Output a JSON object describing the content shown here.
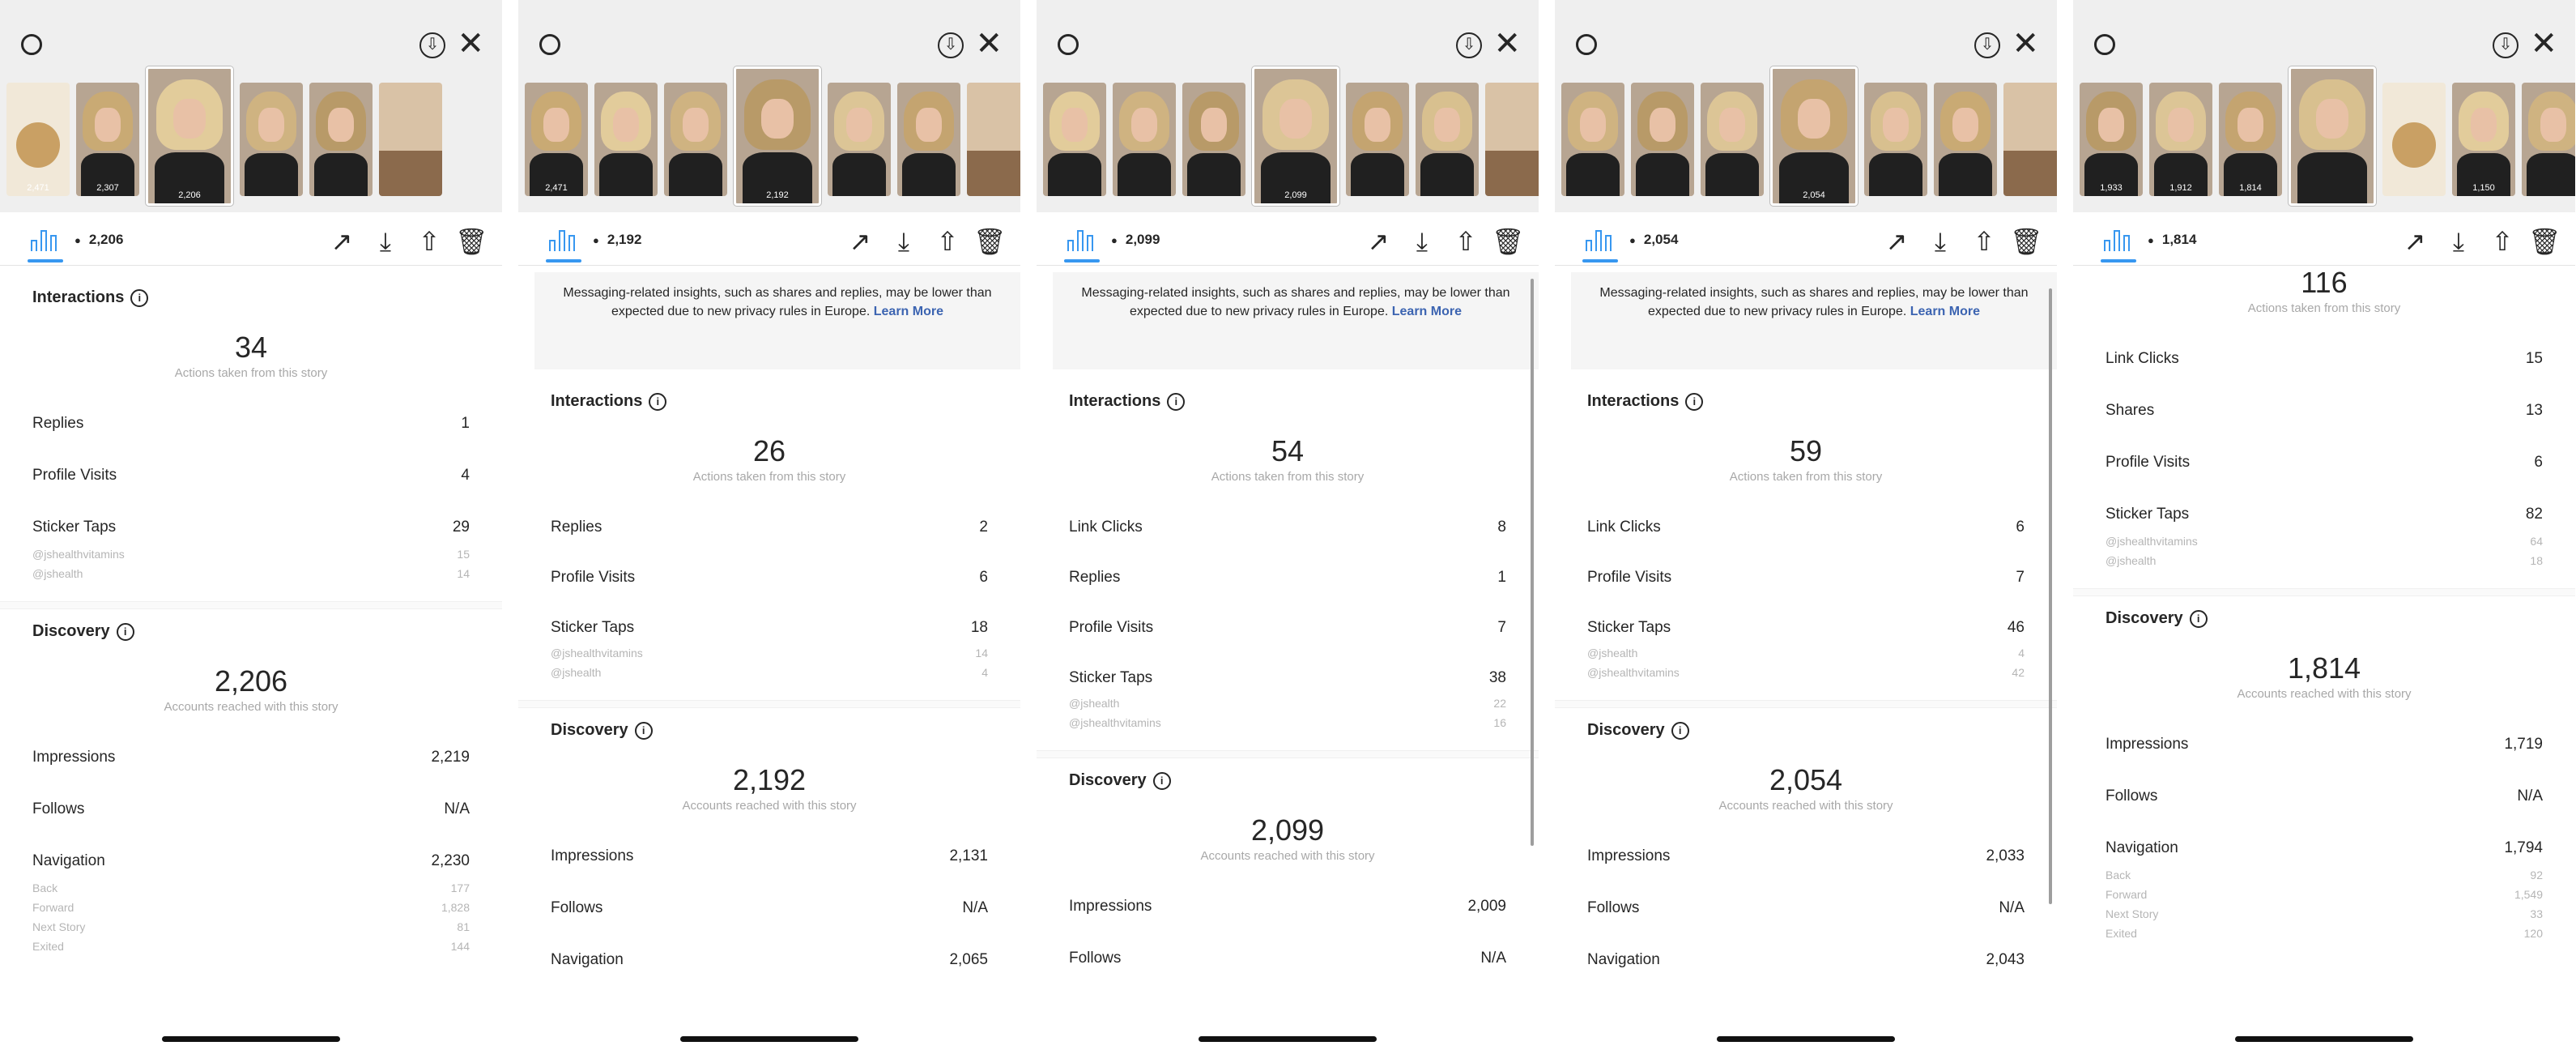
{
  "panels": [
    {
      "reach": "2,206",
      "notice": null,
      "interactions_label": "Interactions",
      "interactions_total": "34",
      "interactions_caption": "Actions taken from this story",
      "rows": [
        {
          "label": "Replies",
          "value": "1"
        },
        {
          "label": "Profile Visits",
          "value": "4"
        },
        {
          "label": "Sticker Taps",
          "value": "29",
          "subs": [
            {
              "label": "@jshealthvitamins",
              "value": "15"
            },
            {
              "label": "@jshealth",
              "value": "14"
            }
          ]
        }
      ],
      "discovery_label": "Discovery",
      "discovery_total": "2,206",
      "discovery_caption": "Accounts reached with this story",
      "discovery_rows": [
        {
          "label": "Impressions",
          "value": "2,219"
        },
        {
          "label": "Follows",
          "value": "N/A"
        },
        {
          "label": "Navigation",
          "value": "2,230",
          "subs": [
            {
              "label": "Back",
              "value": "177"
            },
            {
              "label": "Forward",
              "value": "1,828"
            },
            {
              "label": "Next Story",
              "value": "81"
            },
            {
              "label": "Exited",
              "value": "144"
            }
          ]
        }
      ]
    },
    {
      "reach": "2,192",
      "notice": {
        "text": "Messaging-related insights, such as shares and replies, may be lower than expected due to new privacy rules in Europe.",
        "link": "Learn More"
      },
      "interactions_label": "Interactions",
      "interactions_total": "26",
      "interactions_caption": "Actions taken from this story",
      "rows": [
        {
          "label": "Replies",
          "value": "2"
        },
        {
          "label": "Profile Visits",
          "value": "6"
        },
        {
          "label": "Sticker Taps",
          "value": "18",
          "subs": [
            {
              "label": "@jshealthvitamins",
              "value": "14"
            },
            {
              "label": "@jshealth",
              "value": "4"
            }
          ]
        }
      ],
      "discovery_label": "Discovery",
      "discovery_total": "2,192",
      "discovery_caption": "Accounts reached with this story",
      "discovery_rows": [
        {
          "label": "Impressions",
          "value": "2,131"
        },
        {
          "label": "Follows",
          "value": "N/A"
        },
        {
          "label": "Navigation",
          "value": "2,065"
        }
      ]
    },
    {
      "reach": "2,099",
      "notice": {
        "text": "Messaging-related insights, such as shares and replies, may be lower than expected due to new privacy rules in Europe.",
        "link": "Learn More"
      },
      "interactions_label": "Interactions",
      "interactions_total": "54",
      "interactions_caption": "Actions taken from this story",
      "rows": [
        {
          "label": "Link Clicks",
          "value": "8"
        },
        {
          "label": "Replies",
          "value": "1"
        },
        {
          "label": "Profile Visits",
          "value": "7"
        },
        {
          "label": "Sticker Taps",
          "value": "38",
          "subs": [
            {
              "label": "@jshealth",
              "value": "22"
            },
            {
              "label": "@jshealthvitamins",
              "value": "16"
            }
          ]
        }
      ],
      "discovery_label": "Discovery",
      "discovery_total": "2,099",
      "discovery_caption": "Accounts reached with this story",
      "discovery_rows": [
        {
          "label": "Impressions",
          "value": "2,009"
        },
        {
          "label": "Follows",
          "value": "N/A"
        }
      ]
    },
    {
      "reach": "2,054",
      "notice": {
        "text": "Messaging-related insights, such as shares and replies, may be lower than expected due to new privacy rules in Europe.",
        "link": "Learn More"
      },
      "interactions_label": "Interactions",
      "interactions_total": "59",
      "interactions_caption": "Actions taken from this story",
      "rows": [
        {
          "label": "Link Clicks",
          "value": "6"
        },
        {
          "label": "Profile Visits",
          "value": "7"
        },
        {
          "label": "Sticker Taps",
          "value": "46",
          "subs": [
            {
              "label": "@jshealth",
              "value": "4"
            },
            {
              "label": "@jshealthvitamins",
              "value": "42"
            }
          ]
        }
      ],
      "discovery_label": "Discovery",
      "discovery_total": "2,054",
      "discovery_caption": "Accounts reached with this story",
      "discovery_rows": [
        {
          "label": "Impressions",
          "value": "2,033"
        },
        {
          "label": "Follows",
          "value": "N/A"
        },
        {
          "label": "Navigation",
          "value": "2,043"
        }
      ]
    },
    {
      "reach": "1,814",
      "notice": null,
      "interactions_label": null,
      "interactions_total": "116",
      "interactions_caption": "Actions taken from this story",
      "rows": [
        {
          "label": "Link Clicks",
          "value": "15"
        },
        {
          "label": "Shares",
          "value": "13"
        },
        {
          "label": "Profile Visits",
          "value": "6"
        },
        {
          "label": "Sticker Taps",
          "value": "82",
          "subs": [
            {
              "label": "@jshealthvitamins",
              "value": "64"
            },
            {
              "label": "@jshealth",
              "value": "18"
            }
          ]
        }
      ],
      "discovery_label": "Discovery",
      "discovery_total": "1,814",
      "discovery_caption": "Accounts reached with this story",
      "discovery_rows": [
        {
          "label": "Impressions",
          "value": "1,719"
        },
        {
          "label": "Follows",
          "value": "N/A"
        },
        {
          "label": "Navigation",
          "value": "1,794",
          "subs": [
            {
              "label": "Back",
              "value": "92"
            },
            {
              "label": "Forward",
              "value": "1,549"
            },
            {
              "label": "Next Story",
              "value": "33"
            },
            {
              "label": "Exited",
              "value": "120"
            }
          ]
        }
      ]
    }
  ],
  "thumb_views": [
    [
      "2,471",
      "2,307",
      "2,206",
      "",
      "",
      ""
    ],
    [
      "2,471",
      "",
      "",
      "2,192",
      "",
      "",
      ""
    ],
    [
      "",
      "",
      "",
      "2,099",
      "",
      "",
      ""
    ],
    [
      "",
      "",
      "",
      "2,054",
      "",
      "",
      ""
    ],
    [
      "1,933",
      "1,912",
      "1,814",
      "",
      "",
      "1,150",
      ""
    ]
  ],
  "icons": {
    "close": "✕",
    "download": "⇩",
    "trend": "↗",
    "save": "⤓",
    "share": "⇧",
    "trash": "🗑",
    "eye": "●",
    "info": "i"
  },
  "colors": {
    "accent": "#3797f0",
    "link": "#3c64b1",
    "muted": "#a8a8a8",
    "text": "#262626",
    "story_bg": "#efefef"
  }
}
